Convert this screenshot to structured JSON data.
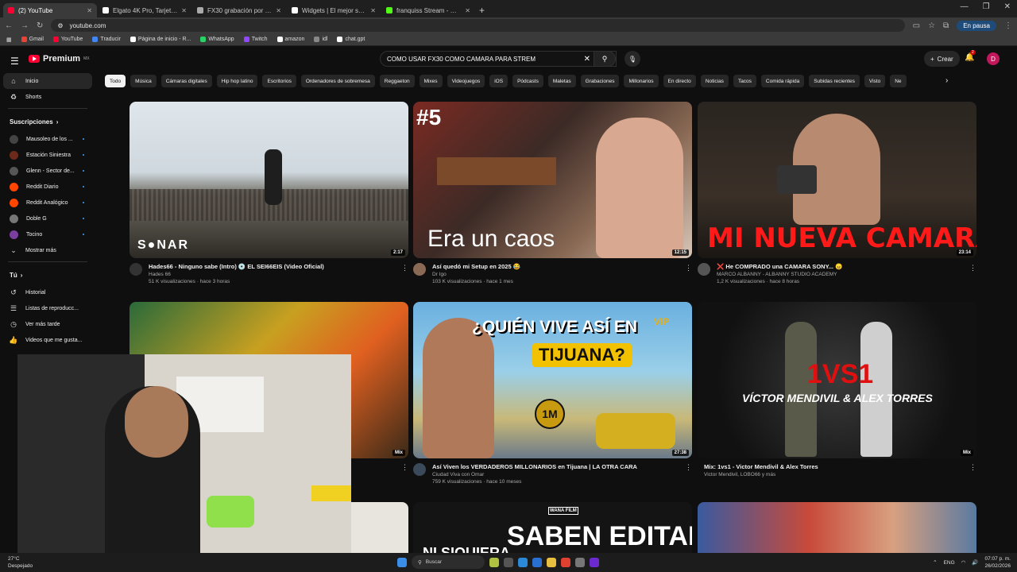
{
  "browser": {
    "tabs": [
      {
        "label": "(2) YouTube",
        "color": "#ff0033",
        "active": true
      },
      {
        "label": "Elgato 4K Pro, Tarjeta de Captu...",
        "color": "#ffffff",
        "active": false
      },
      {
        "label": "FX30 grabación por HDMI",
        "color": "#aaaaaa",
        "active": false
      },
      {
        "label": "Widgets | El mejor software pa...",
        "color": "#ffffff",
        "active": false
      },
      {
        "label": "franquiss Stream - Watch Live ...",
        "color": "#53fc18",
        "active": false
      }
    ],
    "new_tab": "+",
    "address": "youtube.com",
    "profile_status": "En pausa",
    "bookmarks": [
      {
        "label": "Gmail",
        "color": "#ea4335"
      },
      {
        "label": "YouTube",
        "color": "#ff0033"
      },
      {
        "label": "Traducir",
        "color": "#4285f4"
      },
      {
        "label": "Página de inicio - R...",
        "color": "#ffffff"
      },
      {
        "label": "WhatsApp",
        "color": "#25d366"
      },
      {
        "label": "Twitch",
        "color": "#9146ff"
      },
      {
        "label": "amazon",
        "color": "#ffffff"
      },
      {
        "label": "idl",
        "color": "#888888"
      },
      {
        "label": "chat.gpt",
        "color": "#ffffff"
      }
    ]
  },
  "header": {
    "logo_text": "Premium",
    "logo_sup": "MX",
    "search_query": "COMO USAR FX30 COMO CAMARA PARA STREM",
    "create_label": "Crear",
    "notif_count": "2",
    "avatar_letter": "D"
  },
  "sidebar": {
    "main": [
      {
        "label": "Inicio",
        "icon": "home-icon",
        "glyph": "⌂",
        "active": true
      },
      {
        "label": "Shorts",
        "icon": "shorts-icon",
        "glyph": "♻",
        "active": false
      }
    ],
    "subs_heading": "Suscripciones",
    "subs": [
      {
        "label": "Mausoleo de los ...",
        "color": "#444444"
      },
      {
        "label": "Estación Siniestra",
        "color": "#6b2a1a"
      },
      {
        "label": "Glenn - Sector de...",
        "color": "#555555"
      },
      {
        "label": "Reddit Diario",
        "color": "#ff4500"
      },
      {
        "label": "Reddit Analógico",
        "color": "#ff4500"
      },
      {
        "label": "Doble G",
        "color": "#777777"
      },
      {
        "label": "Tocino",
        "color": "#7b3fa0"
      }
    ],
    "show_more": "Mostrar más",
    "you_heading": "Tú",
    "you": [
      {
        "label": "Historial",
        "icon": "history-icon",
        "glyph": "↺"
      },
      {
        "label": "Listas de reproducc...",
        "icon": "playlist-icon",
        "glyph": "☰"
      },
      {
        "label": "Ver más tarde",
        "icon": "clock-icon",
        "glyph": "◷"
      },
      {
        "label": "Videos que me gusta...",
        "icon": "like-icon",
        "glyph": "👍"
      }
    ]
  },
  "chips": [
    "Todo",
    "Música",
    "Cámaras digitales",
    "Hip hop latino",
    "Escritorios",
    "Ordenadores de sobremesa",
    "Reggaeton",
    "Mixes",
    "Videojuegos",
    "iOS",
    "Pódcasts",
    "Maletas",
    "Grabaciones",
    "Millonarios",
    "En directo",
    "Noticias",
    "Tacos",
    "Comida rápida",
    "Subidas recientes",
    "Visto",
    "Ne"
  ],
  "videos": [
    {
      "title": "Hades66 - Ninguno sabe (Intro) 💿 EL SEI66EIS (Video Oficial)",
      "channel": "Hades 66",
      "stats": "51 K visualizaciones · hace 3 horas",
      "duration": "2:17",
      "overlay": "S●NAR"
    },
    {
      "title": "Así quedó mi Setup en 2025 😂",
      "channel": "Dr Igo",
      "stats": "103 K visualizaciones · hace 1 mes",
      "duration": "12:15",
      "overlay": "Era un caos",
      "overlay2": "#5"
    },
    {
      "title": "❌ He COMPRADO una CAMARA SONY... 😠",
      "channel": "MARCO ALBANNY - ALBANNY STUDIO ACADEMY",
      "stats": "1,2 K visualizaciones · hace 8 horas",
      "duration": "23:14",
      "overlay": "MI NUEVA CAMARA!!"
    },
    {
      "title": "",
      "channel": "",
      "stats": "",
      "duration": "Mix",
      "overlay": ""
    },
    {
      "title": "Así Viven los VERDADEROS MILLONARIOS en Tijuana | LA OTRA CARA",
      "channel": "Ciudad Viva con Omar",
      "stats": "759 K visualizaciones · hace 10 meses",
      "duration": "27:38",
      "overlay": "¿QUIÉN VIVE ASÍ EN",
      "overlay2": "TIJUANA?",
      "overlay3": "1M",
      "overlay4": "VIP"
    },
    {
      "title": "Mix: 1vs1 - Victor Mendivil & Alex Torres",
      "channel": "Victor Mendivil, LOBO66 y más",
      "stats": "",
      "duration": "Mix",
      "overlay": "VÍCTOR MENDIVIL & ALEX TORRES",
      "overlay2": "1VS1"
    },
    {
      "title": "",
      "channel": "",
      "stats": "",
      "duration": "",
      "overlay": "SABEN EDITAR",
      "overlay2": "NI SIQUIERA",
      "overlay3": "WANA FILM"
    }
  ],
  "taskbar": {
    "temp": "27°C",
    "weather": "Despejado",
    "search": "Buscar",
    "lang": "ENG",
    "time": "07:07 p. m.",
    "date": "26/02/2026"
  }
}
